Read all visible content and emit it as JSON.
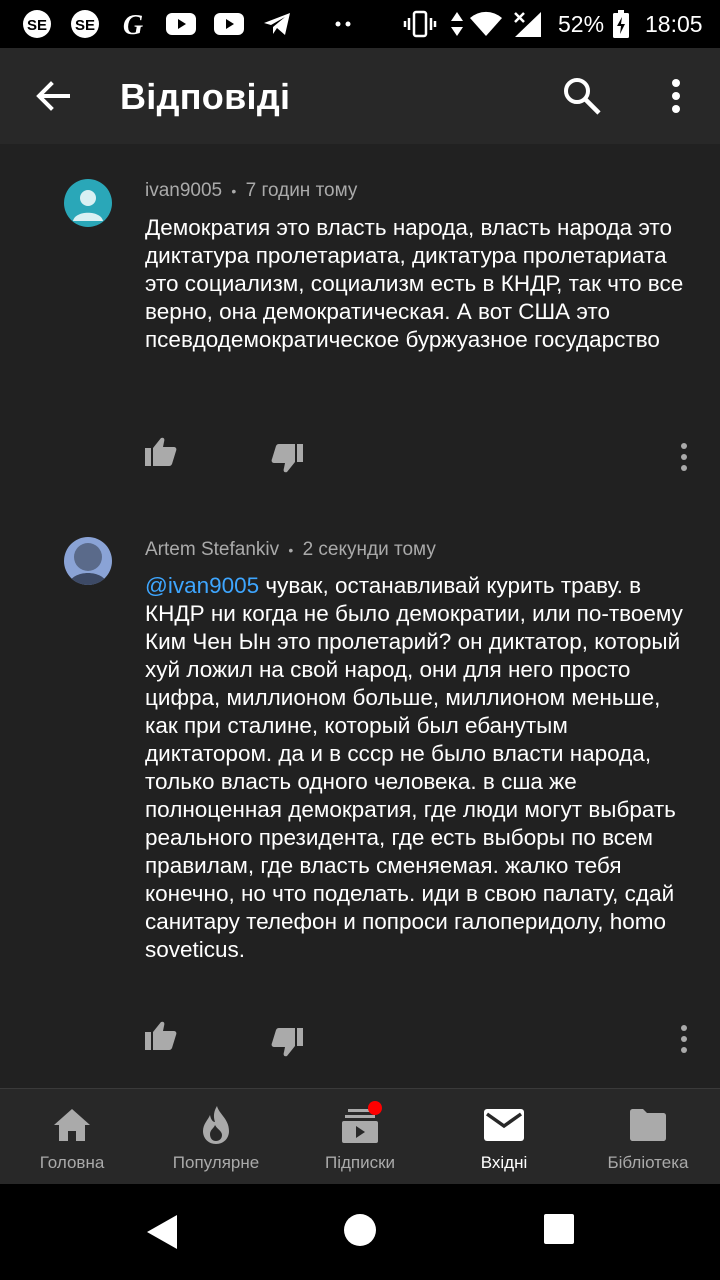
{
  "status_bar": {
    "battery_percent": "52%",
    "time": "18:05",
    "left_icons": [
      "se-app-icon",
      "se-app-icon",
      "g-app-icon",
      "youtube-icon",
      "youtube-icon",
      "telegram-icon",
      "more-notifications-icon"
    ],
    "right_icons": [
      "vibrate-icon",
      "data-arrows-icon",
      "wifi-icon",
      "signal-icon",
      "battery-icon"
    ]
  },
  "app_bar": {
    "title": "Відповіді",
    "back_icon": "arrow-back-icon",
    "search_icon": "search-icon",
    "more_icon": "more-vert-icon"
  },
  "comments": [
    {
      "author": "ivan9005",
      "separator": "•",
      "time": "7 годин тому",
      "avatar_color": "#2aa7b8",
      "text": "Демократия это власть народа, власть народа это диктатура пролетариата, диктатура пролетариата это социализм, социализм есть в КНДР, так что все верно, она демократическая. А вот США это псевдодемократическое буржуазное государство"
    },
    {
      "author": "Artem Stefankiv",
      "separator": "•",
      "time": "2 секунди тому",
      "avatar_color": "#8aa3d6",
      "mention": "@ivan9005",
      "text": " чувак, останавливай курить траву. в КНДР ни когда не было демократии, или по-твоему Ким Чен Ын это пролетарий? он диктатор, который хуй ложил на свой народ, они для него просто цифра, миллионом больше, миллионом меньше, как при сталине, который был ебанутым диктатором. да и в ссср не было власти народа, только власть одного человека. в сша же полноценная демократия, где люди могут выбрать реального президента, где есть выборы по всем правилам, где власть сменяемая. жалко тебя конечно, но что поделать. иди в свою палату, сдай санитару телефон и попроси галоперидолу, homo soveticus."
    }
  ],
  "bottom_nav": [
    {
      "label": "Головна",
      "icon": "home-icon"
    },
    {
      "label": "Популярне",
      "icon": "trending-flame-icon"
    },
    {
      "label": "Підписки",
      "icon": "subscriptions-icon",
      "badge": true
    },
    {
      "label": "Вхідні",
      "icon": "inbox-mail-icon",
      "active": true
    },
    {
      "label": "Бібліотека",
      "icon": "library-folder-icon"
    }
  ],
  "colors": {
    "background": "#212121",
    "app_bar": "#282828",
    "mention": "#3ea6ff",
    "badge": "#ff0000",
    "secondary_text": "#aaaaaa"
  }
}
